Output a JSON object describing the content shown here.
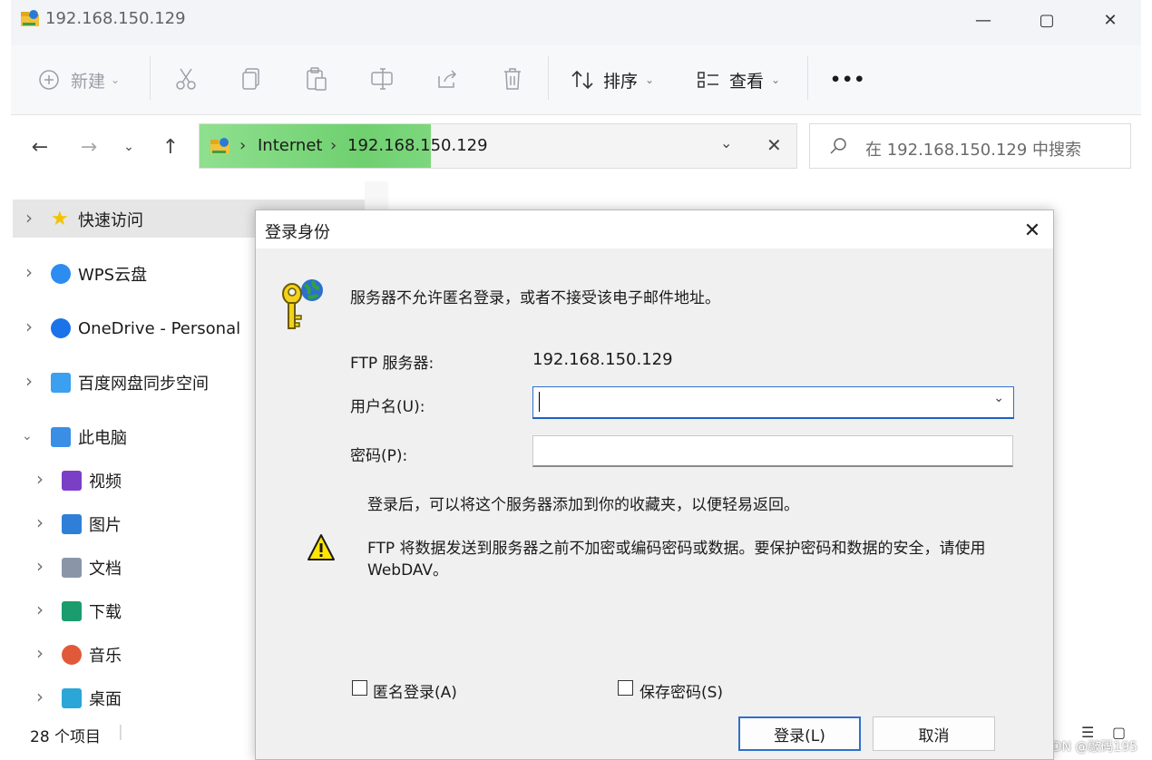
{
  "window": {
    "title": "192.168.150.129",
    "controls": {
      "minimize": "—",
      "maximize": "▢",
      "close": "✕"
    }
  },
  "toolbar": {
    "new_label": "新建",
    "sort_label": "排序",
    "view_label": "查看",
    "more_label": "•••"
  },
  "address": {
    "segments": [
      "Internet",
      "192.168.150.129"
    ],
    "separator": "›"
  },
  "search": {
    "placeholder": "在 192.168.150.129 中搜索"
  },
  "sidebar": {
    "items": [
      {
        "label": "快速访问",
        "icon": "star-icon",
        "color": "#f2c200"
      },
      {
        "label": "WPS云盘",
        "icon": "cloud-icon",
        "color": "#2d8cf0"
      },
      {
        "label": "OneDrive - Personal",
        "icon": "onedrive-icon",
        "color": "#1a73e8"
      },
      {
        "label": "百度网盘同步空间",
        "icon": "baidu-netdisk-icon",
        "color": "#3aa0ef"
      },
      {
        "label": "此电脑",
        "icon": "computer-icon",
        "color": "#3a8ee6"
      },
      {
        "label": "视频",
        "icon": "video-icon",
        "color": "#7b3fc6"
      },
      {
        "label": "图片",
        "icon": "picture-icon",
        "color": "#2f7fd8"
      },
      {
        "label": "文档",
        "icon": "document-icon",
        "color": "#8a96a8"
      },
      {
        "label": "下载",
        "icon": "download-icon",
        "color": "#1a9c6e"
      },
      {
        "label": "音乐",
        "icon": "music-icon",
        "color": "#e05a3a"
      },
      {
        "label": "桌面",
        "icon": "desktop-icon",
        "color": "#2aa7d6"
      }
    ]
  },
  "statusbar": {
    "count": "28 个项目"
  },
  "dialog": {
    "title": "登录身份",
    "close": "✕",
    "message": "服务器不允许匿名登录，或者不接受该电子邮件地址。",
    "ftp_server_label": "FTP 服务器:",
    "ftp_server_value": "192.168.150.129",
    "username_label": "用户名(U):",
    "username_value": "",
    "password_label": "密码(P):",
    "password_value": "",
    "info": "登录后，可以将这个服务器添加到你的收藏夹，以便轻易返回。",
    "warning_line1": "FTP 将数据发送到服务器之前不加密或编码密码或数据。要保护密码和数据的安全，请使用",
    "warning_line2": "WebDAV。",
    "anonymous_label": "匿名登录(A)",
    "save_password_label": "保存密码(S)",
    "login_button": "登录(L)",
    "cancel_button": "取消"
  },
  "watermark": "CSDN @敲码195"
}
